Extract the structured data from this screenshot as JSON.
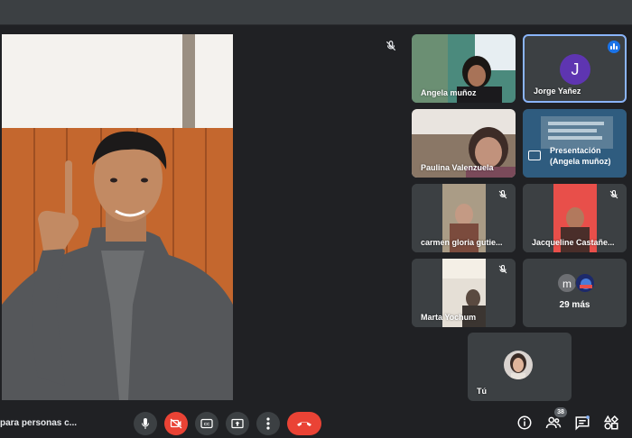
{
  "participants": [
    {
      "name": "Angela muñoz",
      "muted": false
    },
    {
      "name": "Jorge Yañez",
      "initial": "J",
      "speaking": true
    },
    {
      "name": "Paulina Valenzuela",
      "muted": false
    },
    {
      "presentation_line1": "Presentación",
      "presentation_line2": "(Angela muñoz)"
    },
    {
      "name": "carmen gloria gutie...",
      "muted": true
    },
    {
      "name": "Jacqueline Castañe...",
      "muted": true
    },
    {
      "name": "Marta Yochum",
      "muted": true
    }
  ],
  "more": {
    "initial": "m",
    "label": "29 más"
  },
  "self": {
    "name": "Tú"
  },
  "bottom_bar": {
    "meeting_name": "para personas c...",
    "participant_count": "38"
  },
  "colors": {
    "background": "#202124",
    "tile": "#3c4043",
    "hangup": "#ea4335",
    "speaking_accent": "#8ab4f8",
    "avatar_j": "#5e35b1"
  },
  "icons": [
    "mic-icon",
    "camera-off-icon",
    "captions-icon",
    "present-now-icon",
    "more-options-icon",
    "hang-up-icon",
    "info-icon",
    "people-icon",
    "chat-icon",
    "activities-icon",
    "mic-off-icon"
  ]
}
